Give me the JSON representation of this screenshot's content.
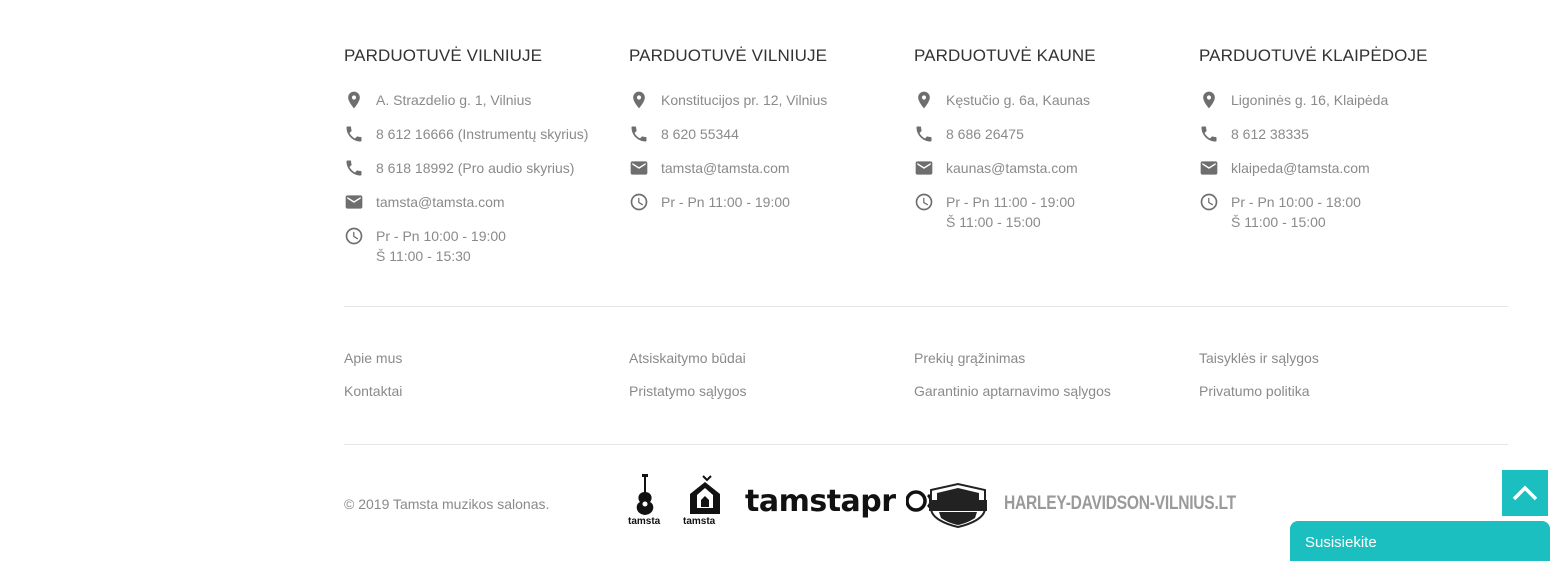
{
  "stores": [
    {
      "title": "PARDUOTUVĖ VILNIUJE",
      "rows": [
        {
          "icon": "location-icon",
          "text": "A. Strazdelio g. 1, Vilnius"
        },
        {
          "icon": "phone-icon",
          "text": "8 612 16666 (Instrumentų skyrius)"
        },
        {
          "icon": "phone-icon",
          "text": "8 618 18992 (Pro audio skyrius)"
        },
        {
          "icon": "email-icon",
          "text": "tamsta@tamsta.com"
        },
        {
          "icon": "clock-icon",
          "text": "Pr - Pn 10:00 - 19:00\nŠ 11:00 - 15:30"
        }
      ]
    },
    {
      "title": "PARDUOTUVĖ VILNIUJE",
      "rows": [
        {
          "icon": "location-icon",
          "text": "Konstitucijos pr. 12, Vilnius"
        },
        {
          "icon": "phone-icon",
          "text": "8 620 55344"
        },
        {
          "icon": "email-icon",
          "text": "tamsta@tamsta.com"
        },
        {
          "icon": "clock-icon",
          "text": "Pr - Pn 11:00 - 19:00"
        }
      ]
    },
    {
      "title": "PARDUOTUVĖ KAUNE",
      "rows": [
        {
          "icon": "location-icon",
          "text": "Kęstučio g. 6a, Kaunas"
        },
        {
          "icon": "phone-icon",
          "text": "8 686 26475"
        },
        {
          "icon": "email-icon",
          "text": "kaunas@tamsta.com"
        },
        {
          "icon": "clock-icon",
          "text": "Pr - Pn 11:00 - 19:00\nŠ 11:00 - 15:00"
        }
      ]
    },
    {
      "title": "PARDUOTUVĖ KLAIPĖDOJE",
      "rows": [
        {
          "icon": "location-icon",
          "text": "Ligoninės g. 16, Klaipėda"
        },
        {
          "icon": "phone-icon",
          "text": "8 612 38335"
        },
        {
          "icon": "email-icon",
          "text": "klaipeda@tamsta.com"
        },
        {
          "icon": "clock-icon",
          "text": "Pr - Pn 10:00 - 18:00\nŠ 11:00 - 15:00"
        }
      ]
    }
  ],
  "links": {
    "about": "Apie mus",
    "contacts": "Kontaktai",
    "payment": "Atsiskaitymo būdai",
    "delivery": "Pristatymo sąlygos",
    "returns": "Prekių grąžinimas",
    "warranty": "Garantinio aptarnavimo sąlygos",
    "terms": "Taisyklės ir sąlygos",
    "privacy": "Privatumo politika"
  },
  "footer": {
    "copyright": "© 2019 Tamsta muzikos salonas.",
    "logos": {
      "tamsta_salonas_label": "tamsta",
      "tamsta_studio_label": "tamsta",
      "tamstapro_label": "tamstapr",
      "harley_site_label": "HARLEY-DAVIDSON-VILNIUS.LT"
    },
    "chat_label": "Susisiekite"
  },
  "colors": {
    "accent": "#1bbfc0",
    "text_muted": "#8a8a8a",
    "heading": "#333333"
  }
}
